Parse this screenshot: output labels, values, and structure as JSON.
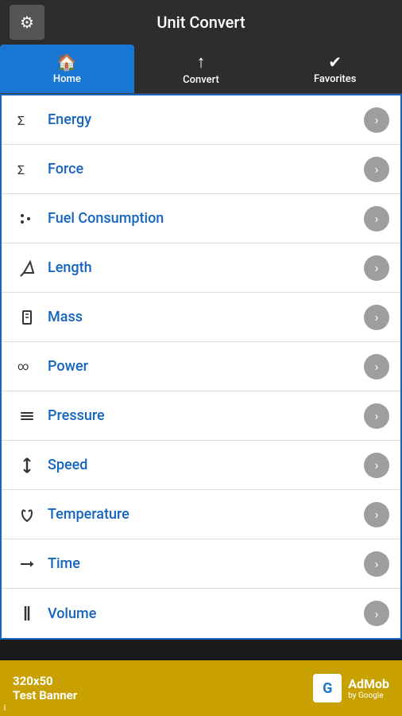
{
  "app": {
    "title": "Unit Convert"
  },
  "topbar": {
    "settings_icon": "⚙"
  },
  "tabs": [
    {
      "id": "home",
      "label": "Home",
      "icon": "🏠",
      "active": true
    },
    {
      "id": "convert",
      "label": "Convert",
      "icon": "↑",
      "active": false
    },
    {
      "id": "favorites",
      "label": "Favorites",
      "icon": "✔",
      "active": false
    }
  ],
  "list": {
    "items": [
      {
        "id": "energy",
        "label": "Energy",
        "icon": "Σ"
      },
      {
        "id": "force",
        "label": "Force",
        "icon": "Σ"
      },
      {
        "id": "fuel-consumption",
        "label": "Fuel Consumption",
        "icon": "⁚"
      },
      {
        "id": "length",
        "label": "Length",
        "icon": "△"
      },
      {
        "id": "mass",
        "label": "Mass",
        "icon": "⬜"
      },
      {
        "id": "power",
        "label": "Power",
        "icon": "∞"
      },
      {
        "id": "pressure",
        "label": "Pressure",
        "icon": "≡"
      },
      {
        "id": "speed",
        "label": "Speed",
        "icon": "↕"
      },
      {
        "id": "temperature",
        "label": "Temperature",
        "icon": "☎"
      },
      {
        "id": "time",
        "label": "Time",
        "icon": "→"
      },
      {
        "id": "volume",
        "label": "Volume",
        "icon": "‖"
      }
    ]
  },
  "ad": {
    "line1": "320x50",
    "line2": "Test Banner",
    "logo_text": "G",
    "brand": "AdMob",
    "sub": "by Google"
  }
}
